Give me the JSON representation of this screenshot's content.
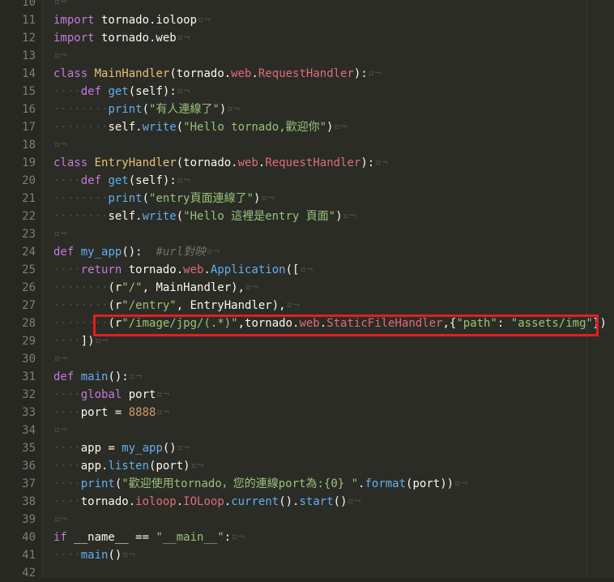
{
  "editor": {
    "colors": {
      "background": "#2b2c26",
      "keyword": "#c678dd",
      "function": "#61afef",
      "class": "#e5c07b",
      "string": "#98c379",
      "number": "#d19a66",
      "highlight": "#e02020"
    },
    "lines": [
      {
        "n": "10",
        "tokens": [
          {
            "t": "¤¬",
            "c": "inv"
          }
        ]
      },
      {
        "n": "11",
        "tokens": [
          {
            "t": "import",
            "c": "kw"
          },
          {
            "t": " tornado.ioloop"
          },
          {
            "t": "¤¬",
            "c": "inv"
          }
        ]
      },
      {
        "n": "12",
        "tokens": [
          {
            "t": "import",
            "c": "kw"
          },
          {
            "t": " tornado.web"
          },
          {
            "t": "¤¬",
            "c": "inv"
          }
        ]
      },
      {
        "n": "13",
        "tokens": [
          {
            "t": "¤¬",
            "c": "inv"
          }
        ]
      },
      {
        "n": "14",
        "tokens": [
          {
            "t": "class",
            "c": "kw"
          },
          {
            "t": " "
          },
          {
            "t": "MainHandler",
            "c": "cls"
          },
          {
            "t": "(tornado."
          },
          {
            "t": "web",
            "c": "attr"
          },
          {
            "t": "."
          },
          {
            "t": "RequestHandler",
            "c": "attr"
          },
          {
            "t": "):"
          },
          {
            "t": "¤¬",
            "c": "inv"
          }
        ]
      },
      {
        "n": "15",
        "tokens": [
          {
            "t": "····",
            "c": "ws"
          },
          {
            "t": "def",
            "c": "kw"
          },
          {
            "t": " "
          },
          {
            "t": "get",
            "c": "fn"
          },
          {
            "t": "(self):"
          },
          {
            "t": "¤¬",
            "c": "inv"
          }
        ]
      },
      {
        "n": "16",
        "tokens": [
          {
            "t": "········",
            "c": "ws"
          },
          {
            "t": "print",
            "c": "fn"
          },
          {
            "t": "("
          },
          {
            "t": "\"有人連線了\"",
            "c": "str"
          },
          {
            "t": ")"
          },
          {
            "t": "¤¬",
            "c": "inv"
          }
        ]
      },
      {
        "n": "17",
        "tokens": [
          {
            "t": "········",
            "c": "ws"
          },
          {
            "t": "self."
          },
          {
            "t": "write",
            "c": "fn"
          },
          {
            "t": "("
          },
          {
            "t": "\"Hello tornado,歡迎你\"",
            "c": "str"
          },
          {
            "t": ")"
          },
          {
            "t": "¤¬",
            "c": "inv"
          }
        ]
      },
      {
        "n": "18",
        "tokens": [
          {
            "t": "¤¬",
            "c": "inv"
          }
        ]
      },
      {
        "n": "19",
        "tokens": [
          {
            "t": "class",
            "c": "kw"
          },
          {
            "t": " "
          },
          {
            "t": "EntryHandler",
            "c": "cls"
          },
          {
            "t": "(tornado."
          },
          {
            "t": "web",
            "c": "attr"
          },
          {
            "t": "."
          },
          {
            "t": "RequestHandler",
            "c": "attr"
          },
          {
            "t": "):"
          },
          {
            "t": "¤¬",
            "c": "inv"
          }
        ]
      },
      {
        "n": "20",
        "tokens": [
          {
            "t": "····",
            "c": "ws"
          },
          {
            "t": "def",
            "c": "kw"
          },
          {
            "t": " "
          },
          {
            "t": "get",
            "c": "fn"
          },
          {
            "t": "(self):"
          },
          {
            "t": "¤¬",
            "c": "inv"
          }
        ]
      },
      {
        "n": "21",
        "tokens": [
          {
            "t": "········",
            "c": "ws"
          },
          {
            "t": "print",
            "c": "fn"
          },
          {
            "t": "("
          },
          {
            "t": "\"entry頁面連線了\"",
            "c": "str"
          },
          {
            "t": ")"
          },
          {
            "t": "¤¬",
            "c": "inv"
          }
        ]
      },
      {
        "n": "22",
        "tokens": [
          {
            "t": "········",
            "c": "ws"
          },
          {
            "t": "self."
          },
          {
            "t": "write",
            "c": "fn"
          },
          {
            "t": "("
          },
          {
            "t": "\"Hello 這裡是entry 頁面\"",
            "c": "str"
          },
          {
            "t": ")"
          },
          {
            "t": "¤¬",
            "c": "inv"
          }
        ]
      },
      {
        "n": "23",
        "tokens": [
          {
            "t": "¤¬",
            "c": "inv"
          }
        ]
      },
      {
        "n": "24",
        "tokens": [
          {
            "t": "def",
            "c": "kw"
          },
          {
            "t": " "
          },
          {
            "t": "my_app",
            "c": "fn"
          },
          {
            "t": "():  "
          },
          {
            "t": "#url對映",
            "c": "cmt"
          },
          {
            "t": "¤¬",
            "c": "inv"
          }
        ]
      },
      {
        "n": "25",
        "tokens": [
          {
            "t": "····",
            "c": "ws"
          },
          {
            "t": "return",
            "c": "kw"
          },
          {
            "t": " tornado."
          },
          {
            "t": "web",
            "c": "attr"
          },
          {
            "t": "."
          },
          {
            "t": "Application",
            "c": "fn"
          },
          {
            "t": "(["
          },
          {
            "t": "¤¬",
            "c": "inv"
          }
        ]
      },
      {
        "n": "26",
        "tokens": [
          {
            "t": "········",
            "c": "ws"
          },
          {
            "t": "(r"
          },
          {
            "t": "\"/\"",
            "c": "str"
          },
          {
            "t": ", MainHandler),"
          },
          {
            "t": "¤¬",
            "c": "inv"
          }
        ]
      },
      {
        "n": "27",
        "tokens": [
          {
            "t": "········",
            "c": "ws"
          },
          {
            "t": "(r"
          },
          {
            "t": "\"/entry\"",
            "c": "str"
          },
          {
            "t": ", EntryHandler),"
          },
          {
            "t": "¤¬",
            "c": "inv"
          }
        ]
      },
      {
        "n": "28",
        "tokens": [
          {
            "t": "········",
            "c": "ws"
          },
          {
            "t": "(r"
          },
          {
            "t": "\"/image/jpg/(.*)\"",
            "c": "str"
          },
          {
            "t": ",tornado."
          },
          {
            "t": "web",
            "c": "attr"
          },
          {
            "t": "."
          },
          {
            "t": "StaticFileHandler",
            "c": "attr"
          },
          {
            "t": ",{"
          },
          {
            "t": "\"path\"",
            "c": "str"
          },
          {
            "t": ": "
          },
          {
            "t": "\"assets/img\"",
            "c": "str"
          },
          {
            "t": "})"
          }
        ]
      },
      {
        "n": "29",
        "tokens": [
          {
            "t": "····",
            "c": "ws"
          },
          {
            "t": "])"
          },
          {
            "t": "¤¬",
            "c": "inv"
          }
        ]
      },
      {
        "n": "30",
        "tokens": [
          {
            "t": "¤¬",
            "c": "inv"
          }
        ]
      },
      {
        "n": "31",
        "tokens": [
          {
            "t": "def",
            "c": "kw"
          },
          {
            "t": " "
          },
          {
            "t": "main",
            "c": "fn"
          },
          {
            "t": "():"
          },
          {
            "t": "¤¬",
            "c": "inv"
          }
        ]
      },
      {
        "n": "32",
        "tokens": [
          {
            "t": "····",
            "c": "ws"
          },
          {
            "t": "global",
            "c": "kw"
          },
          {
            "t": " port"
          },
          {
            "t": "¤¬",
            "c": "inv"
          }
        ]
      },
      {
        "n": "33",
        "tokens": [
          {
            "t": "····",
            "c": "ws"
          },
          {
            "t": "port = "
          },
          {
            "t": "8888",
            "c": "num"
          },
          {
            "t": "¤¬",
            "c": "inv"
          }
        ]
      },
      {
        "n": "34",
        "tokens": [
          {
            "t": "¤¬",
            "c": "inv"
          }
        ]
      },
      {
        "n": "35",
        "tokens": [
          {
            "t": "····",
            "c": "ws"
          },
          {
            "t": "app = "
          },
          {
            "t": "my_app",
            "c": "fn"
          },
          {
            "t": "()"
          },
          {
            "t": "¤¬",
            "c": "inv"
          }
        ]
      },
      {
        "n": "36",
        "tokens": [
          {
            "t": "····",
            "c": "ws"
          },
          {
            "t": "app."
          },
          {
            "t": "listen",
            "c": "fn"
          },
          {
            "t": "(port)"
          },
          {
            "t": "¤¬",
            "c": "inv"
          }
        ]
      },
      {
        "n": "37",
        "tokens": [
          {
            "t": "····",
            "c": "ws"
          },
          {
            "t": "print",
            "c": "fn"
          },
          {
            "t": "("
          },
          {
            "t": "\"歡迎使用tornado，您的連線port為:{0} \"",
            "c": "str"
          },
          {
            "t": "."
          },
          {
            "t": "format",
            "c": "fn"
          },
          {
            "t": "(port))"
          },
          {
            "t": "¤¬",
            "c": "inv"
          }
        ]
      },
      {
        "n": "38",
        "tokens": [
          {
            "t": "····",
            "c": "ws"
          },
          {
            "t": "tornado."
          },
          {
            "t": "ioloop",
            "c": "attr"
          },
          {
            "t": "."
          },
          {
            "t": "IOLoop",
            "c": "attr"
          },
          {
            "t": "."
          },
          {
            "t": "current",
            "c": "fn"
          },
          {
            "t": "()."
          },
          {
            "t": "start",
            "c": "fn"
          },
          {
            "t": "()"
          },
          {
            "t": "¤¬",
            "c": "inv"
          }
        ]
      },
      {
        "n": "39",
        "tokens": [
          {
            "t": "¤¬",
            "c": "inv"
          }
        ]
      },
      {
        "n": "40",
        "tokens": [
          {
            "t": "if",
            "c": "kw"
          },
          {
            "t": " __name__ == "
          },
          {
            "t": "\"__main__\"",
            "c": "str"
          },
          {
            "t": ":"
          },
          {
            "t": "¤¬",
            "c": "inv"
          }
        ]
      },
      {
        "n": "41",
        "tokens": [
          {
            "t": "····",
            "c": "ws"
          },
          {
            "t": "main",
            "c": "fn"
          },
          {
            "t": "()"
          },
          {
            "t": "¤¬",
            "c": "inv"
          }
        ]
      },
      {
        "n": "42",
        "tokens": []
      }
    ]
  }
}
